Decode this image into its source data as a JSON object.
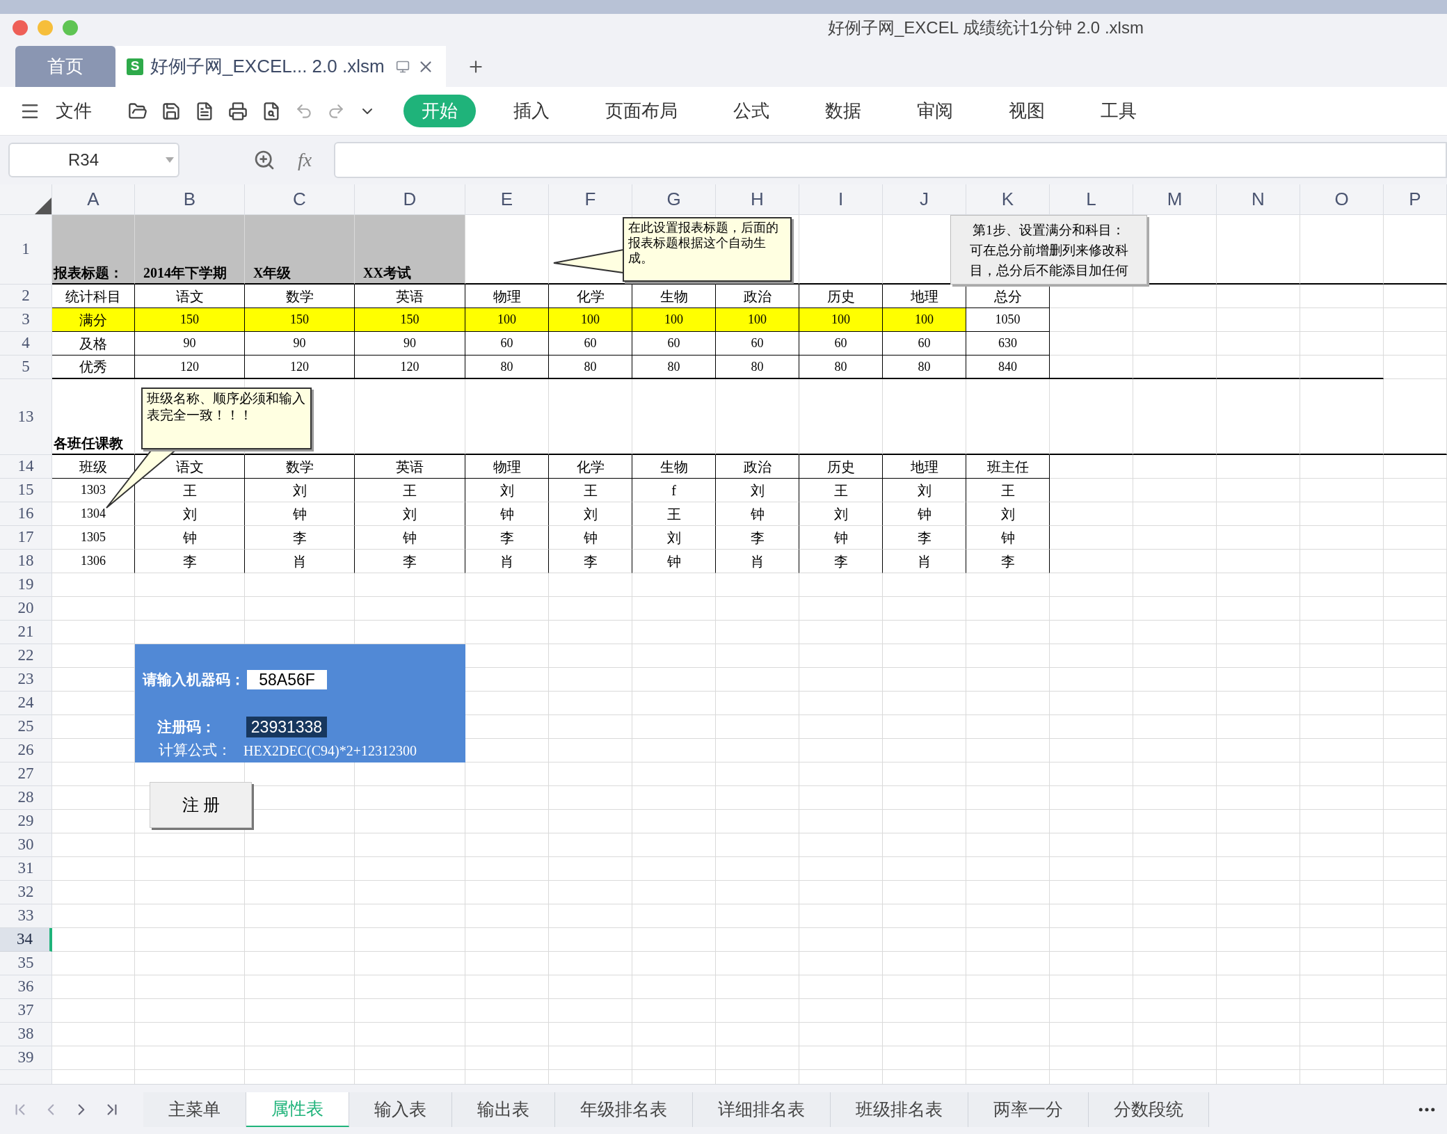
{
  "window": {
    "title": "好例子网_EXCEL 成绩统计1分钟 2.0 .xlsm"
  },
  "document_tabs": [
    {
      "label": "首页",
      "selected": false,
      "kind": "home"
    },
    {
      "label": "好例子网_EXCEL... 2.0 .xlsm",
      "selected": true,
      "kind": "file",
      "icon_letter": "S"
    }
  ],
  "toolbar": {
    "file_menu": "文件",
    "ribbon_tabs": [
      {
        "label": "开始",
        "selected": true
      },
      {
        "label": "插入",
        "selected": false
      },
      {
        "label": "页面布局",
        "selected": false
      },
      {
        "label": "公式",
        "selected": false
      },
      {
        "label": "数据",
        "selected": false
      },
      {
        "label": "审阅",
        "selected": false
      },
      {
        "label": "视图",
        "selected": false
      },
      {
        "label": "工具",
        "selected": false
      }
    ]
  },
  "formula_bar": {
    "name_box": "R34",
    "fx": "fx"
  },
  "columns": [
    "A",
    "B",
    "C",
    "D",
    "E",
    "F",
    "G",
    "H",
    "I",
    "J",
    "K",
    "L",
    "M",
    "N",
    "O",
    "P"
  ],
  "rows": [
    {
      "number": "1",
      "selected": false
    },
    {
      "number": "2",
      "selected": false
    },
    {
      "number": "3",
      "selected": false
    },
    {
      "number": "4",
      "selected": false
    },
    {
      "number": "5",
      "selected": false
    },
    {
      "number": "13",
      "selected": false
    },
    {
      "number": "14",
      "selected": false
    },
    {
      "number": "15",
      "selected": false
    },
    {
      "number": "16",
      "selected": false
    },
    {
      "number": "17",
      "selected": false
    },
    {
      "number": "18",
      "selected": false
    },
    {
      "number": "19",
      "selected": false
    },
    {
      "number": "20",
      "selected": false
    },
    {
      "number": "21",
      "selected": false
    },
    {
      "number": "22",
      "selected": false
    },
    {
      "number": "23",
      "selected": false
    },
    {
      "number": "24",
      "selected": false
    },
    {
      "number": "25",
      "selected": false
    },
    {
      "number": "26",
      "selected": false
    },
    {
      "number": "27",
      "selected": false
    },
    {
      "number": "28",
      "selected": false
    },
    {
      "number": "29",
      "selected": false
    },
    {
      "number": "30",
      "selected": false
    },
    {
      "number": "31",
      "selected": false
    },
    {
      "number": "32",
      "selected": false
    },
    {
      "number": "33",
      "selected": false
    },
    {
      "number": "34",
      "selected": true
    },
    {
      "number": "35",
      "selected": false
    },
    {
      "number": "36",
      "selected": false
    },
    {
      "number": "37",
      "selected": false
    },
    {
      "number": "38",
      "selected": false
    },
    {
      "number": "39",
      "selected": false
    }
  ],
  "report_title": {
    "label": "报表标题：",
    "values": [
      "2014年下学期",
      "X年级",
      "XX考试"
    ]
  },
  "score_table": {
    "label_header": "统计科目",
    "subjects": [
      "语文",
      "数学",
      "英语",
      "物理",
      "化学",
      "生物",
      "政治",
      "历史",
      "地理"
    ],
    "total_header": "总分",
    "rows": [
      {
        "label": "满分",
        "highlighted": true,
        "values": [
          "150",
          "150",
          "150",
          "100",
          "100",
          "100",
          "100",
          "100",
          "100"
        ],
        "total": "1050"
      },
      {
        "label": "及格",
        "highlighted": false,
        "values": [
          "90",
          "90",
          "90",
          "60",
          "60",
          "60",
          "60",
          "60",
          "60"
        ],
        "total": "630"
      },
      {
        "label": "优秀",
        "highlighted": false,
        "values": [
          "120",
          "120",
          "120",
          "80",
          "80",
          "80",
          "80",
          "80",
          "80"
        ],
        "total": "840"
      }
    ]
  },
  "teacher_table": {
    "caption": "各班任课教",
    "class_header": "班级",
    "subjects": [
      "语文",
      "数学",
      "英语",
      "物理",
      "化学",
      "生物",
      "政治",
      "历史",
      "地理"
    ],
    "head_header": "班主任",
    "rows": [
      {
        "class": "1303",
        "teachers": [
          "王",
          "刘",
          "王",
          "刘",
          "王",
          "f",
          "刘",
          "王",
          "刘"
        ],
        "head": "王"
      },
      {
        "class": "1304",
        "teachers": [
          "刘",
          "钟",
          "刘",
          "钟",
          "刘",
          "王",
          "钟",
          "刘",
          "钟"
        ],
        "head": "刘"
      },
      {
        "class": "1305",
        "teachers": [
          "钟",
          "李",
          "钟",
          "李",
          "钟",
          "刘",
          "李",
          "钟",
          "李"
        ],
        "head": "钟"
      },
      {
        "class": "1306",
        "teachers": [
          "李",
          "肖",
          "李",
          "肖",
          "李",
          "钟",
          "肖",
          "李",
          "肖"
        ],
        "head": "李"
      }
    ]
  },
  "notes": [
    {
      "text": "在此设置报表标题，后面的报表标题根据这个自动生成。"
    },
    {
      "text": "班级名称、顺序必须和输入表完全一致！！！"
    },
    {
      "text": "第1步、设置满分和科目：可在总分前增删列来修改科目，总分后不能添目加任何"
    }
  ],
  "registration": {
    "machine_label": "请输入机器码：",
    "machine_code": "58A56F",
    "code_label": "注册码：",
    "code": "23931338",
    "formula_label": "计算公式：",
    "formula": "HEX2DEC(C94)*2+12312300",
    "button": "注 册"
  },
  "sheet_tabs": [
    {
      "label": "主菜单",
      "selected": false
    },
    {
      "label": "属性表",
      "selected": true
    },
    {
      "label": "输入表",
      "selected": false
    },
    {
      "label": "输出表",
      "selected": false
    },
    {
      "label": "年级排名表",
      "selected": false
    },
    {
      "label": "详细排名表",
      "selected": false
    },
    {
      "label": "班级排名表",
      "selected": false
    },
    {
      "label": "两率一分",
      "selected": false
    },
    {
      "label": "分数段统",
      "selected": false
    }
  ]
}
